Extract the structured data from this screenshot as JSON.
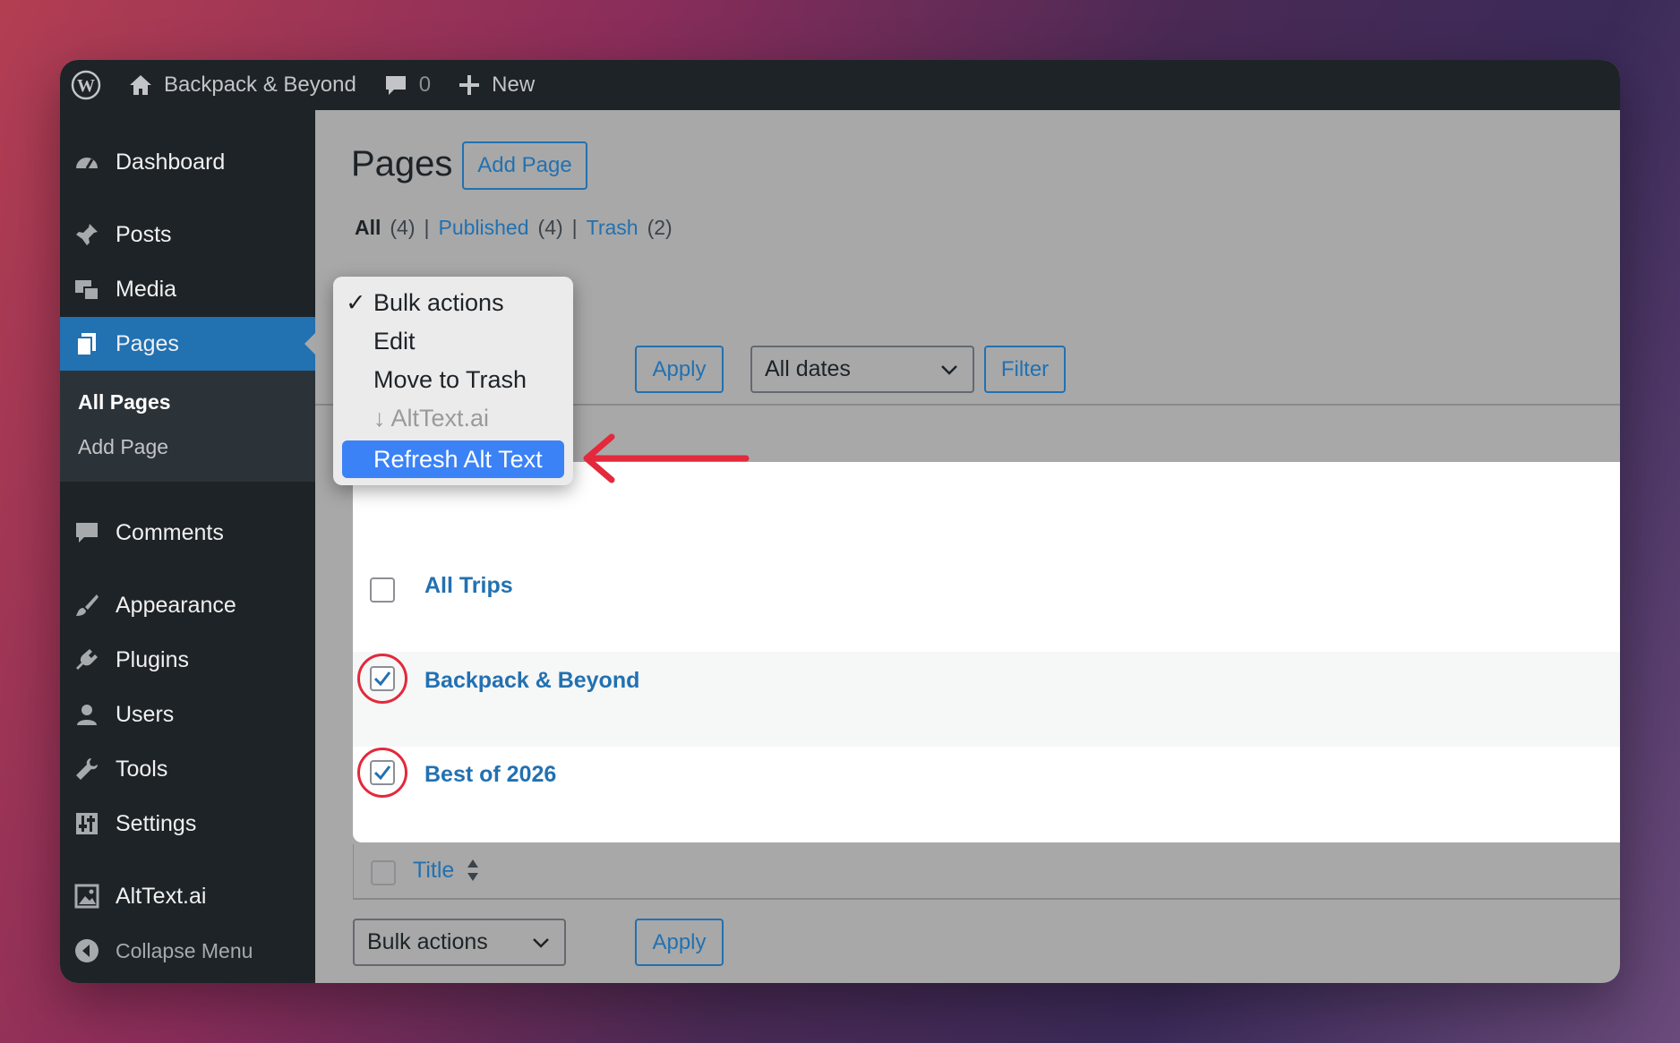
{
  "adminbar": {
    "site_name": "Backpack & Beyond",
    "comments_count": "0",
    "new_label": "New"
  },
  "sidebar": {
    "items": [
      {
        "label": "Dashboard"
      },
      {
        "label": "Posts"
      },
      {
        "label": "Media"
      },
      {
        "label": "Pages"
      },
      {
        "label": "Comments"
      },
      {
        "label": "Appearance"
      },
      {
        "label": "Plugins"
      },
      {
        "label": "Users"
      },
      {
        "label": "Tools"
      },
      {
        "label": "Settings"
      },
      {
        "label": "AltText.ai"
      }
    ],
    "submenu": [
      {
        "label": "All Pages"
      },
      {
        "label": "Add Page"
      }
    ],
    "collapse_label": "Collapse Menu"
  },
  "main": {
    "title": "Pages",
    "add_page_label": "Add Page",
    "filters": {
      "all": "All",
      "all_count": "(4)",
      "published": "Published",
      "published_count": "(4)",
      "trash": "Trash",
      "trash_count": "(2)",
      "separator": "|"
    },
    "apply_label": "Apply",
    "dates_select": "All dates",
    "filter_label": "Filter",
    "rows": [
      {
        "title": "All Trips",
        "checked": false
      },
      {
        "title": "Backpack & Beyond",
        "checked": true
      },
      {
        "title": "Best of 2026",
        "checked": true
      }
    ],
    "footer_column": "Title",
    "bottom_bulk_select": "Bulk actions",
    "bottom_apply_label": "Apply"
  },
  "bulk_dropdown": {
    "options": [
      "Bulk actions",
      "Edit",
      "Move to Trash"
    ],
    "group_label": "↓ AltText.ai",
    "highlighted": "Refresh Alt Text",
    "check_mark": "✓"
  },
  "colors": {
    "accent": "#2271b1",
    "sidebar_bg": "#1d2327",
    "annotation": "#e3293b",
    "highlight": "#3b82f6"
  }
}
